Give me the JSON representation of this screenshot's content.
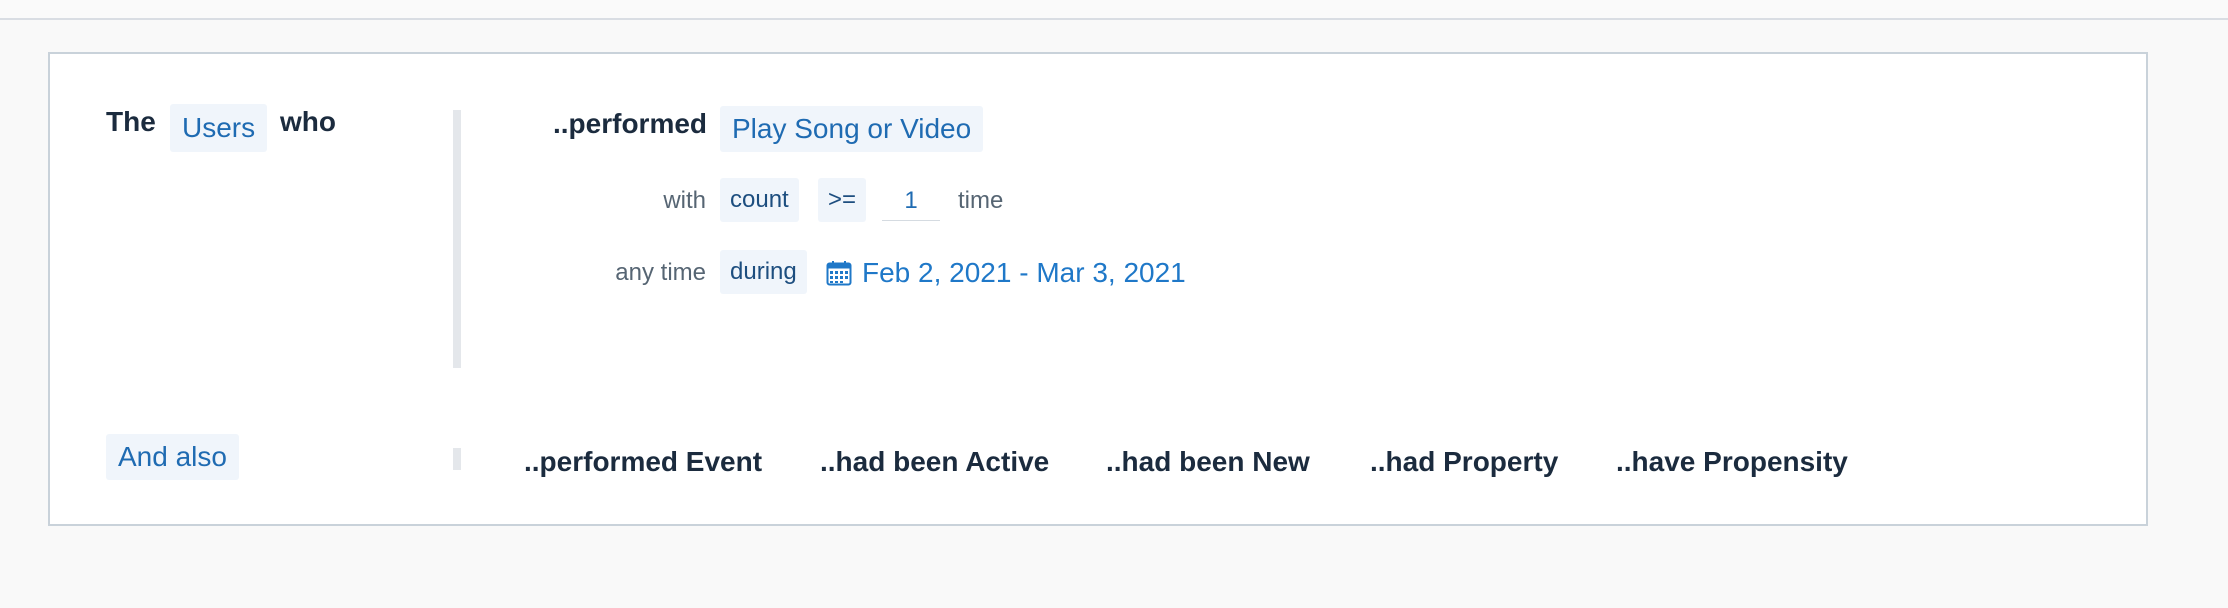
{
  "header": {
    "the": "The",
    "entity": "Users",
    "who": "who"
  },
  "condition": {
    "verb": "..performed",
    "event": "Play Song or Video",
    "with_label": "with",
    "metric": "count",
    "operator": ">=",
    "threshold": "1",
    "unit": "time",
    "time_scope": "any time",
    "time_op": "during",
    "date_range": "Feb 2, 2021 - Mar 3, 2021",
    "date_icon": "calendar-icon"
  },
  "and_also": {
    "label": "And also",
    "options": [
      "..performed Event",
      "..had been Active",
      "..had been New",
      "..had Property",
      "..have Propensity"
    ]
  },
  "colors": {
    "link_blue": "#1f78c8",
    "chip_bg": "#f0f5fb",
    "text_dark": "#1b2b3e"
  }
}
